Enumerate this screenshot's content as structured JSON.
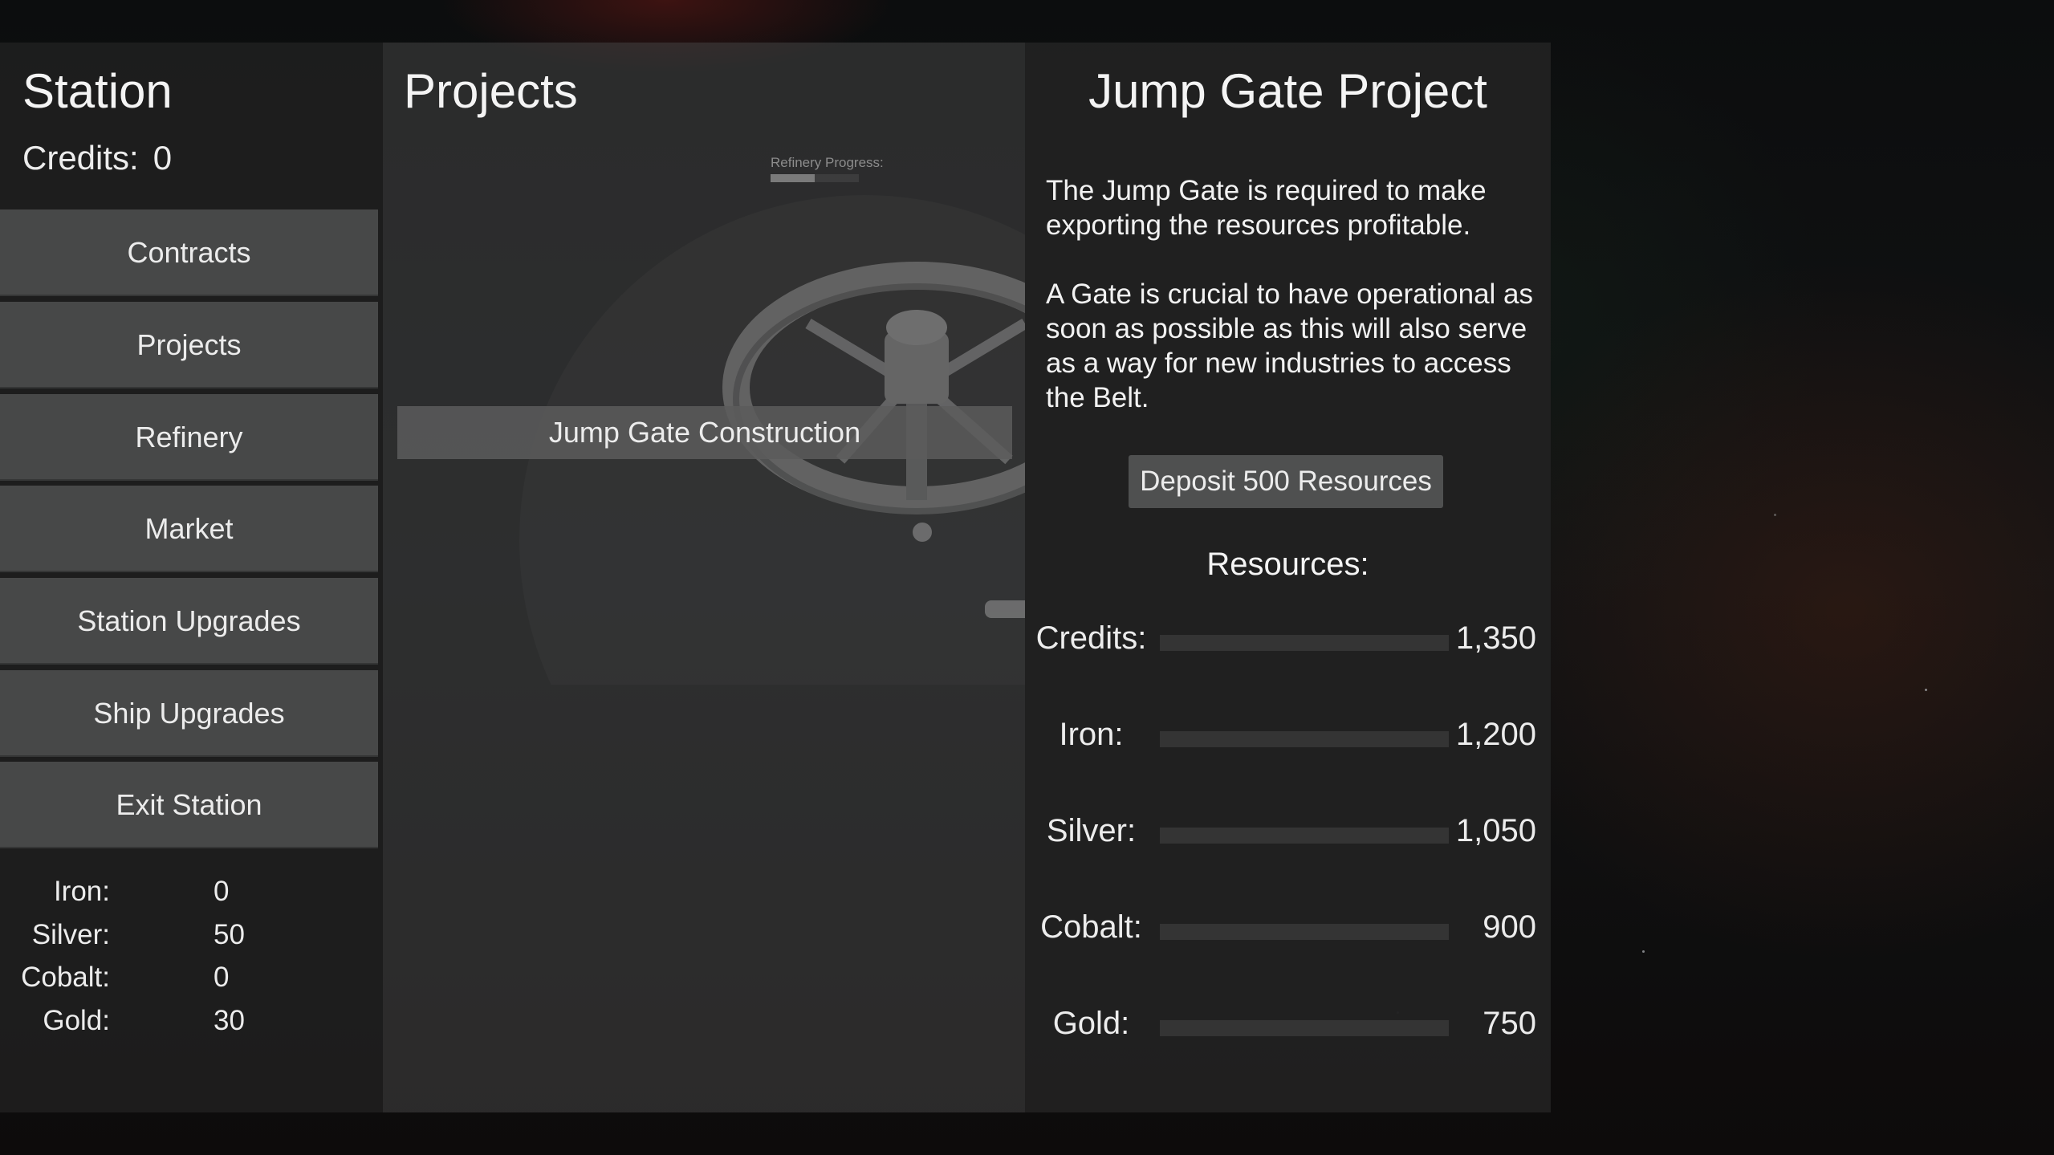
{
  "station": {
    "title": "Station",
    "credits_label": "Credits:",
    "credits_value": "0",
    "menu": [
      {
        "label": "Contracts"
      },
      {
        "label": "Projects"
      },
      {
        "label": "Refinery"
      },
      {
        "label": "Market"
      },
      {
        "label": "Station Upgrades"
      },
      {
        "label": "Ship Upgrades"
      },
      {
        "label": "Exit Station"
      }
    ],
    "inventory": [
      {
        "label": "Iron:",
        "value": "0"
      },
      {
        "label": "Silver:",
        "value": "50"
      },
      {
        "label": "Cobalt:",
        "value": "0"
      },
      {
        "label": "Gold:",
        "value": "30"
      }
    ]
  },
  "projects": {
    "title": "Projects",
    "refinery_progress_label": "Refinery Progress:",
    "refinery_progress": 0.5,
    "items": [
      {
        "label": "Jump Gate Construction"
      }
    ]
  },
  "detail": {
    "title": "Jump Gate Project",
    "paragraph1": "The Jump Gate is required to make exporting the resources profitable.",
    "paragraph2": "A Gate is crucial to have operational as soon as possible as this will also serve as a way for new industries to access the Belt.",
    "deposit_label": "Deposit 500 Resources",
    "resources_heading": "Resources:",
    "requirements": [
      {
        "label": "Credits:",
        "value": "1,350",
        "progress": 0
      },
      {
        "label": "Iron:",
        "value": "1,200",
        "progress": 0
      },
      {
        "label": "Silver:",
        "value": "1,050",
        "progress": 0
      },
      {
        "label": "Cobalt:",
        "value": "900",
        "progress": 0
      },
      {
        "label": "Gold:",
        "value": "750",
        "progress": 0
      }
    ]
  }
}
